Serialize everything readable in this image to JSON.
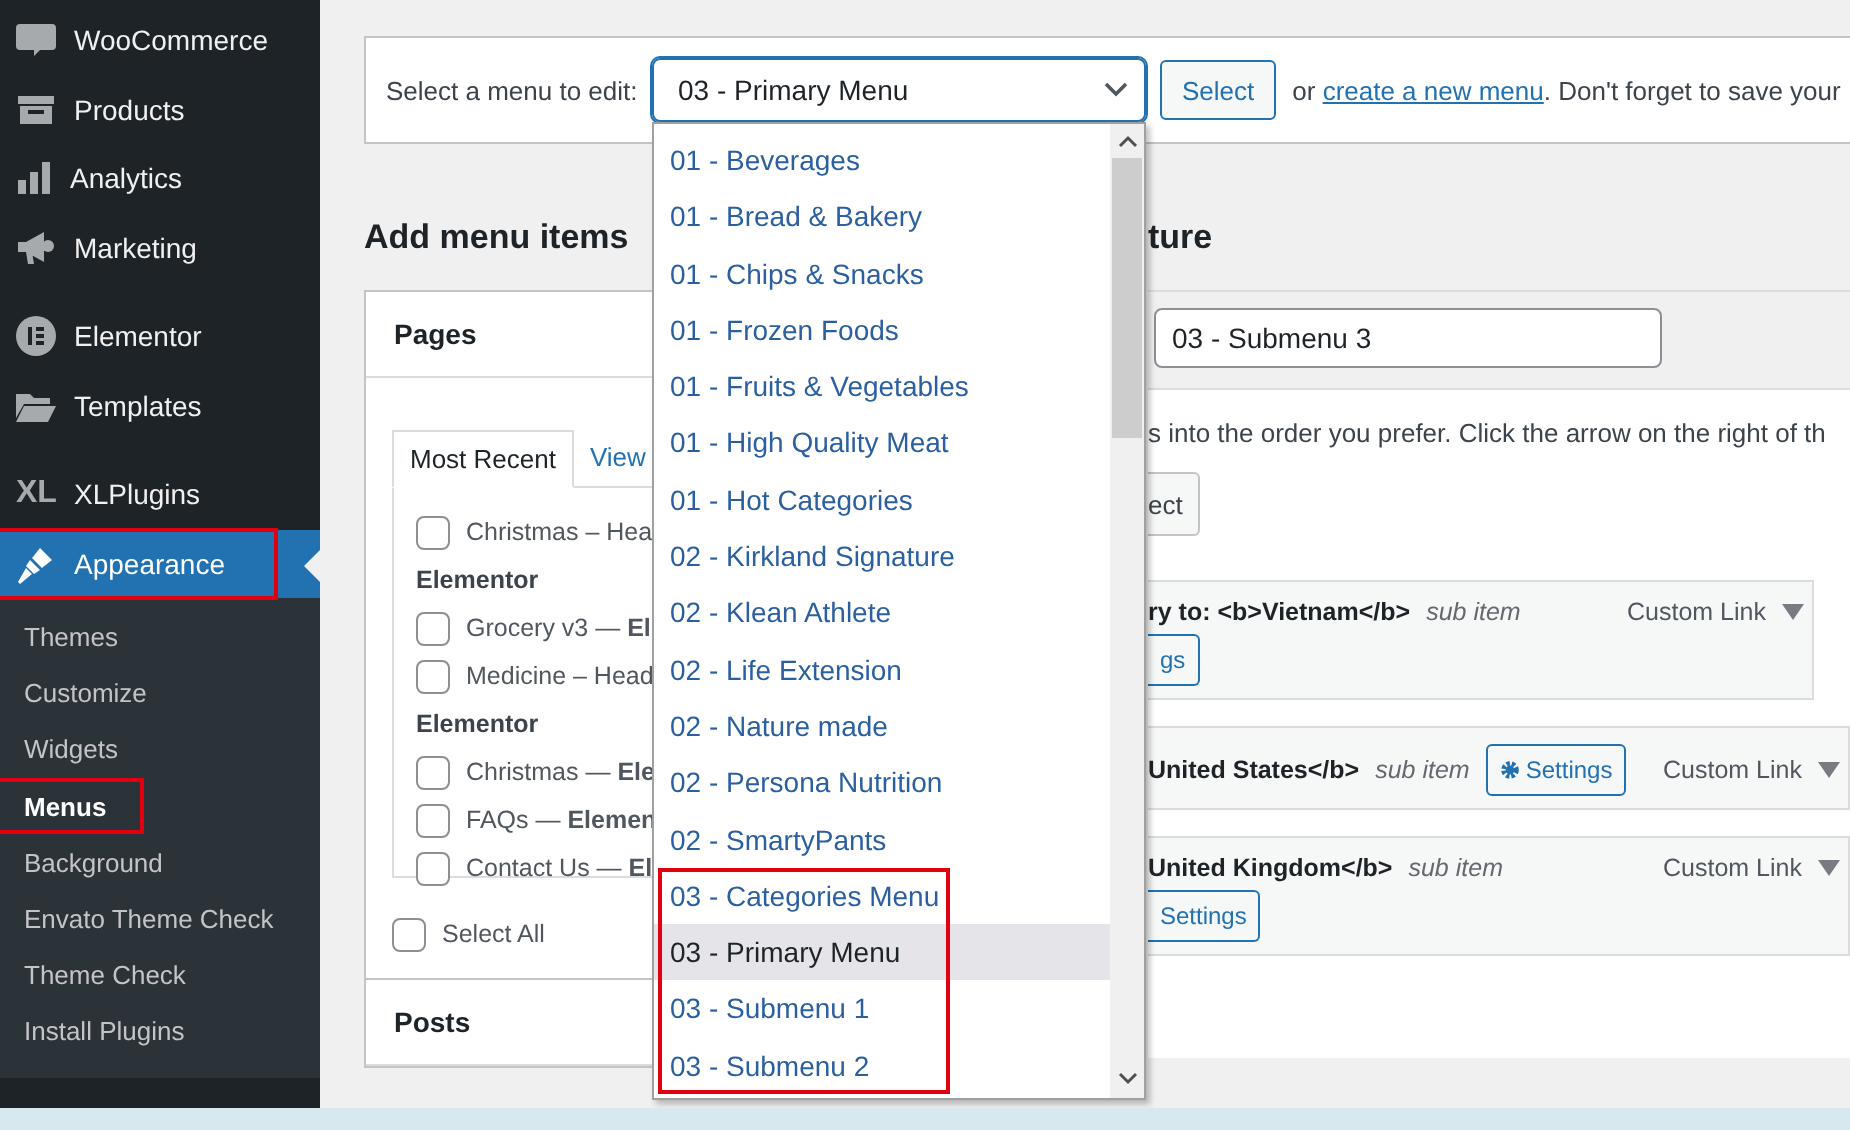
{
  "sidebar": {
    "items": [
      {
        "label": "WooCommerce",
        "selected": false
      },
      {
        "label": "Products",
        "selected": false
      },
      {
        "label": "Analytics",
        "selected": false
      },
      {
        "label": "Marketing",
        "selected": false
      },
      {
        "label": "Elementor",
        "selected": false
      },
      {
        "label": "Templates",
        "selected": false
      },
      {
        "label": "XLPlugins",
        "badge": "XL",
        "selected": false
      },
      {
        "label": "Appearance",
        "selected": true
      }
    ],
    "submenu": [
      {
        "label": "Themes",
        "selected": false
      },
      {
        "label": "Customize",
        "selected": false
      },
      {
        "label": "Widgets",
        "selected": false
      },
      {
        "label": "Menus",
        "selected": true
      },
      {
        "label": "Background",
        "selected": false
      },
      {
        "label": "Envato Theme Check",
        "selected": false
      },
      {
        "label": "Theme Check",
        "selected": false
      },
      {
        "label": "Install Plugins",
        "selected": false
      }
    ]
  },
  "menu_selector": {
    "label": "Select a menu to edit:",
    "value": "03 - Primary Menu",
    "button": "Select",
    "note_before": "or",
    "link": "create a new menu",
    "note_after": ". Don't forget to save your"
  },
  "dropdown": {
    "options": [
      {
        "label": "01 - Beverages",
        "selected": false
      },
      {
        "label": "01 - Bread & Bakery",
        "selected": false
      },
      {
        "label": "01 - Chips & Snacks",
        "selected": false
      },
      {
        "label": "01 - Frozen Foods",
        "selected": false
      },
      {
        "label": "01 - Fruits & Vegetables",
        "selected": false
      },
      {
        "label": "01 - High Quality Meat",
        "selected": false
      },
      {
        "label": "01 - Hot Categories",
        "selected": false
      },
      {
        "label": "02 - Kirkland Signature",
        "selected": false
      },
      {
        "label": "02 - Klean Athlete",
        "selected": false
      },
      {
        "label": "02 - Life Extension",
        "selected": false
      },
      {
        "label": "02 - Nature made",
        "selected": false
      },
      {
        "label": "02 - Persona Nutrition",
        "selected": false
      },
      {
        "label": "02 - SmartyPants",
        "selected": false
      },
      {
        "label": "03 - Categories Menu",
        "selected": false
      },
      {
        "label": "03 - Primary Menu",
        "selected": true
      },
      {
        "label": "03 - Submenu 1",
        "selected": false
      },
      {
        "label": "03 - Submenu 2",
        "selected": false
      }
    ]
  },
  "add_items": {
    "heading": "Add menu items",
    "pages_panel": {
      "title": "Pages",
      "tabs": [
        {
          "label": "Most Recent",
          "selected": true
        },
        {
          "label": "View",
          "selected": false
        }
      ],
      "items": [
        {
          "kind": "checkbox",
          "label": "Christmas – Hea",
          "checked": false
        },
        {
          "kind": "group",
          "label": "Elementor"
        },
        {
          "kind": "checkbox",
          "label": "Grocery v3 — **El**",
          "checked": false
        },
        {
          "kind": "checkbox",
          "label": "Medicine – Head",
          "checked": false
        },
        {
          "kind": "group",
          "label": "Elementor"
        },
        {
          "kind": "checkbox",
          "label": "Christmas — **Ele**",
          "checked": false
        },
        {
          "kind": "checkbox",
          "label": "FAQs — **Elemen**",
          "checked": false
        },
        {
          "kind": "checkbox",
          "label": "Contact Us — **El**",
          "checked": false
        }
      ],
      "select_all": {
        "label": "Select All",
        "checked": false
      }
    },
    "posts_panel": {
      "title": "Posts"
    }
  },
  "menu_structure": {
    "heading": "ture",
    "menu_name": "03 - Submenu 3",
    "instructions": "s into the order you prefer. Click the arrow on the right of th",
    "button": "ect",
    "items": [
      {
        "title": "ry to: <b>Vietnam</b>",
        "sub": "sub item",
        "type": "Custom Link",
        "settings": {
          "label": "gs",
          "kind": "below",
          "gear": false
        }
      },
      {
        "title": "United States</b>",
        "sub": "sub item",
        "type": "Custom Link",
        "settings": {
          "label": "Settings",
          "kind": "inline",
          "gear": true
        }
      },
      {
        "title": "United Kingdom</b>",
        "sub": "sub item",
        "type": "Custom Link",
        "settings": {
          "label": "Settings",
          "kind": "below",
          "gear": false
        }
      }
    ]
  }
}
